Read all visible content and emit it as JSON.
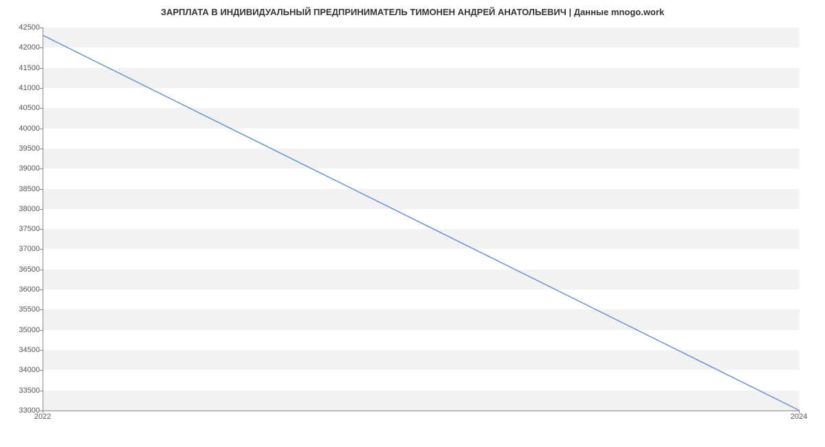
{
  "chart_data": {
    "type": "line",
    "title": "ЗАРПЛАТА В ИНДИВИДУАЛЬНЫЙ ПРЕДПРИНИМАТЕЛЬ ТИМОНЕН АНДРЕЙ АНАТОЛЬЕВИЧ | Данные mnogo.work",
    "x": [
      2022,
      2024
    ],
    "values": [
      42300,
      33000
    ],
    "xlabel": "",
    "ylabel": "",
    "xlim": [
      2022,
      2024
    ],
    "ylim": [
      33000,
      42500
    ],
    "x_ticks": [
      2022,
      2024
    ],
    "y_ticks": [
      33000,
      33500,
      34000,
      34500,
      35000,
      35500,
      36000,
      36500,
      37000,
      37500,
      38000,
      38500,
      39000,
      39500,
      40000,
      40500,
      41000,
      41500,
      42000,
      42500
    ],
    "line_color": "#6c8ed6"
  }
}
